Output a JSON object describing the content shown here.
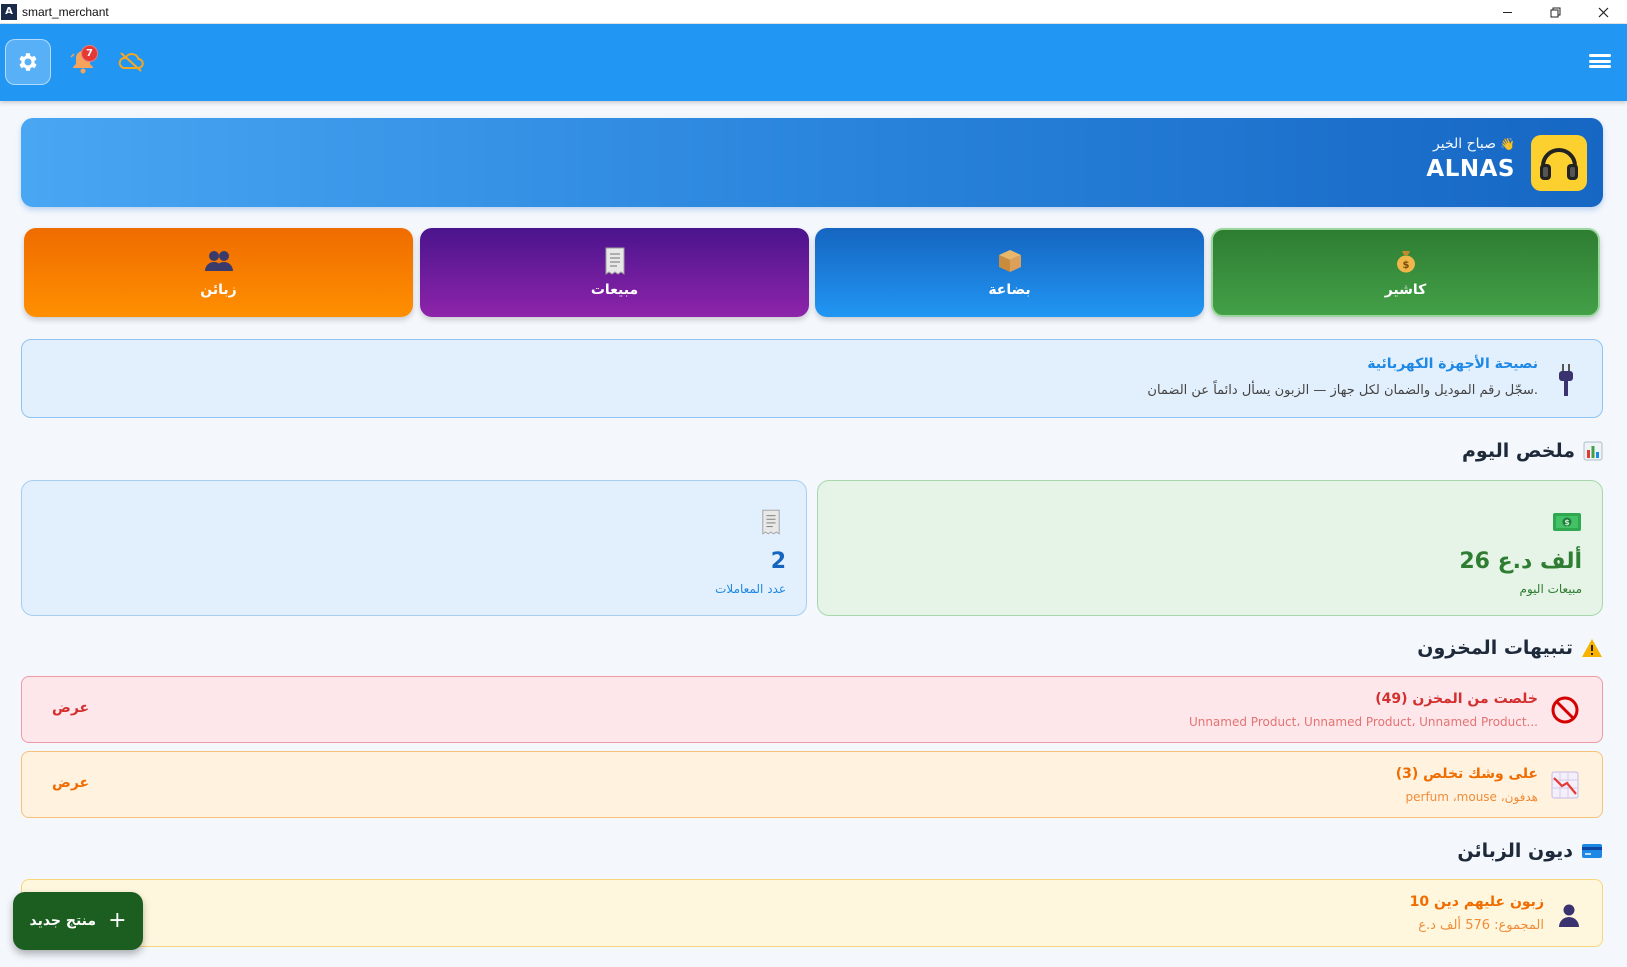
{
  "window": {
    "title": "smart_merchant",
    "logo_text": "A",
    "controls": [
      "minimize-icon",
      "restore-icon",
      "close-icon"
    ]
  },
  "appbar": {
    "color": "#2196f3",
    "notification_count": "7",
    "icons": [
      "gear-icon",
      "bell-icon",
      "cloud-off-icon",
      "menu-icon"
    ]
  },
  "greeting": {
    "hello": "صباح الخير",
    "hello_emoji": "👋",
    "name": "ALNAS",
    "avatar_icon": "headphones-icon"
  },
  "actions": [
    {
      "label": "كاشير",
      "icon": "money-bag-icon",
      "color": "#43a047"
    },
    {
      "label": "بضاعة",
      "icon": "package-icon",
      "color": "#2196f3"
    },
    {
      "label": "مبيعات",
      "icon": "receipt-icon",
      "color": "#8e24aa"
    },
    {
      "label": "زبائن",
      "icon": "people-icon",
      "color": "#ff8f00"
    }
  ],
  "tip": {
    "title": "نصيحة الأجهزة الكهربائية",
    "body": "سجّل رقم الموديل والضمان لكل جهاز — الزبون يسأل دائماً عن الضمان.",
    "icon": "plug-icon"
  },
  "today": {
    "header": "ملخص اليوم",
    "header_icon": "bar-chart-icon",
    "sales_value": "26 ألف د.ع",
    "sales_label": "مبيعات اليوم",
    "sales_icon": "cash-icon",
    "txn_value": "2",
    "txn_label": "عدد المعاملات",
    "txn_icon": "receipt-icon"
  },
  "stock": {
    "header": "تنبيهات المخزون",
    "header_icon": "warning-icon",
    "out": {
      "title": "خلصت من المخزن (49)",
      "items": "Unnamed Product، Unnamed Product، Unnamed Product...",
      "view": "عرض",
      "icon": "prohibited-icon"
    },
    "low": {
      "title": "على وشك تخلص (3)",
      "items": "perfum ،mouse ،هدفون",
      "view": "عرض",
      "icon": "chart-decreasing-icon"
    }
  },
  "debts": {
    "header": "ديون الزبائن",
    "header_icon": "credit-card-icon",
    "title": "10 زبون عليهم دين",
    "total": "المجموع: 576 ألف د.ع",
    "icon": "person-icon"
  },
  "fab": {
    "label": "منتج جديد",
    "plus": "+"
  }
}
